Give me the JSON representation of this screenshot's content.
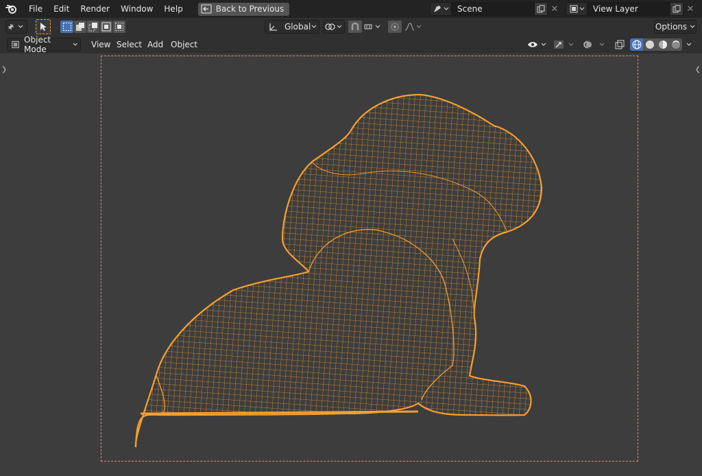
{
  "menus": [
    "File",
    "Edit",
    "Render",
    "Window",
    "Help"
  ],
  "back_button": "Back to Previous",
  "scene": {
    "name": "Scene"
  },
  "view_layer": {
    "name": "View Layer"
  },
  "toolbar": {
    "transform_orientation": "Global",
    "options_label": "Options"
  },
  "header": {
    "mode": "Object Mode",
    "menus": [
      "View",
      "Select",
      "Add",
      "Object"
    ]
  },
  "colors": {
    "wire": "#f09a2e",
    "camera_frame": "#d98b7a",
    "viewport_bg": "#3d3d3d"
  }
}
